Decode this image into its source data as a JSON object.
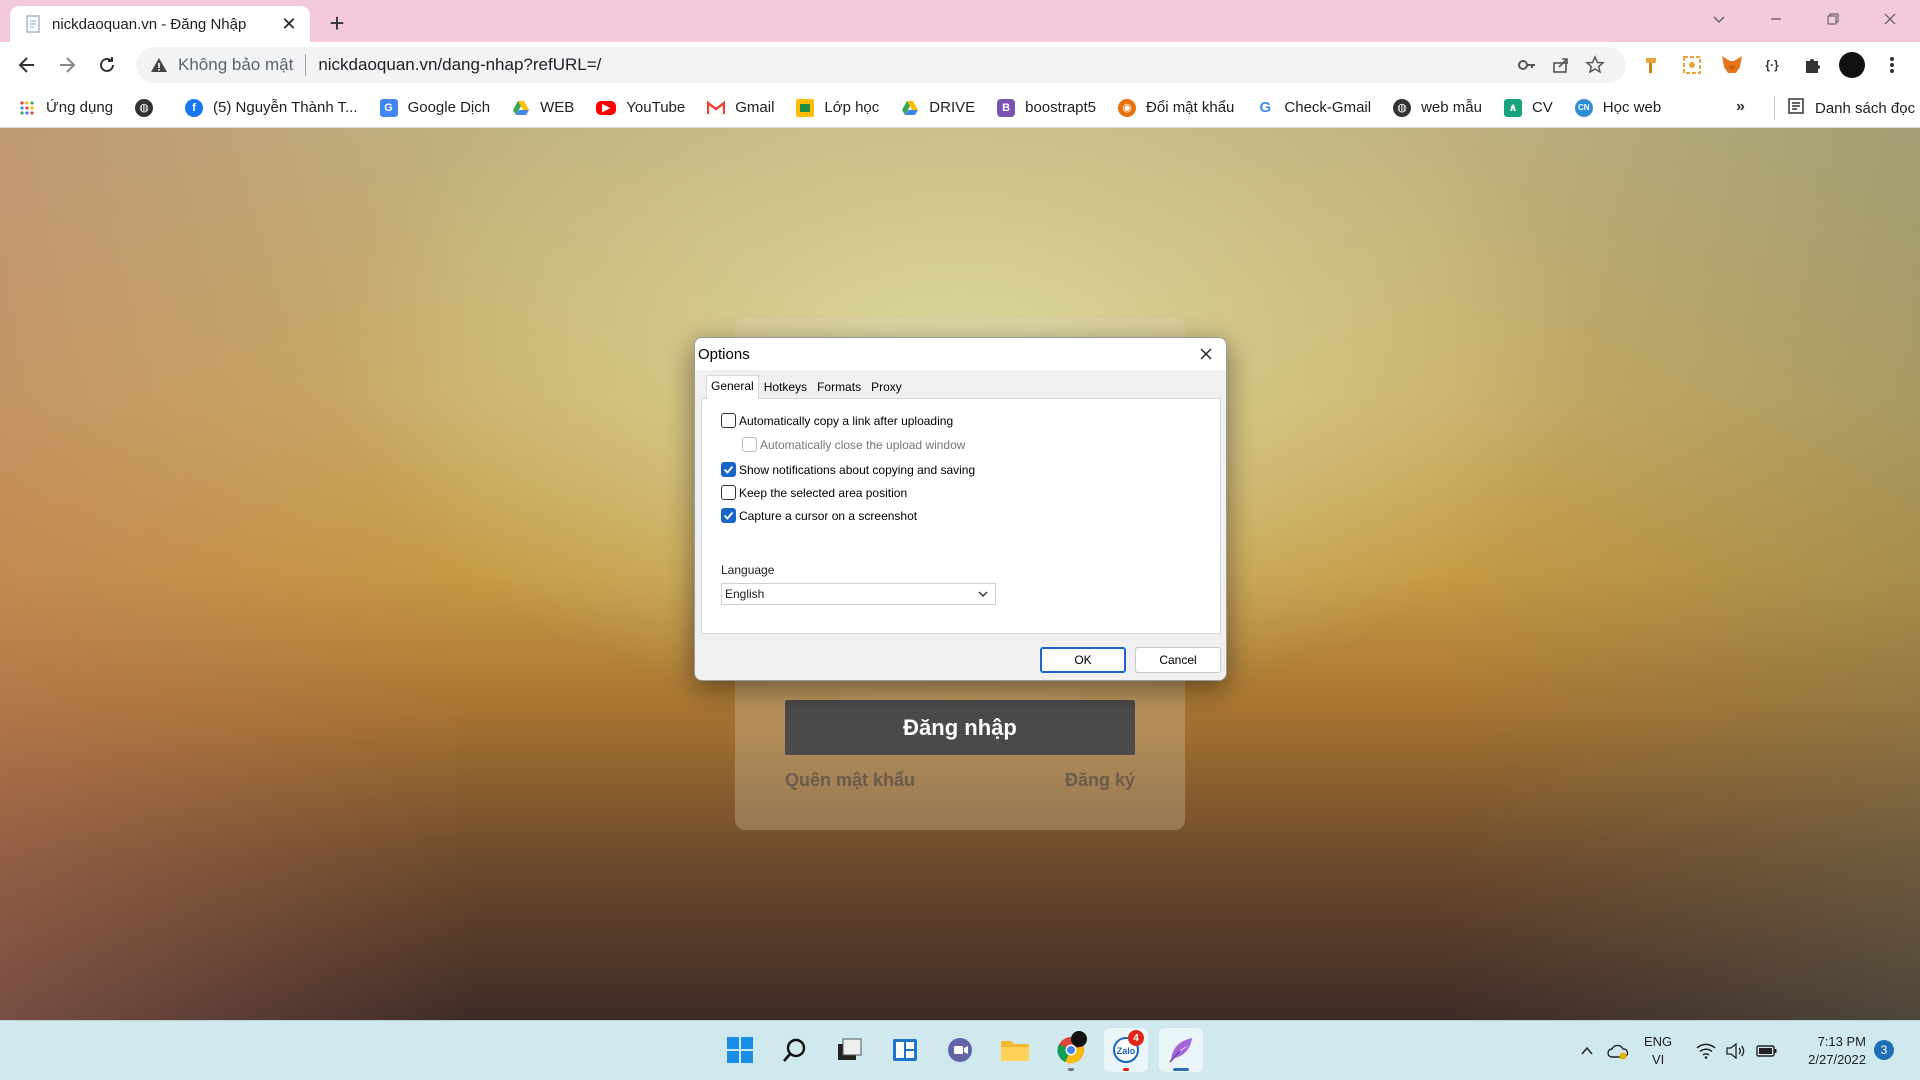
{
  "browser": {
    "tab_title": "nickdaoquan.vn - Đăng Nhập",
    "new_tab_icon": "plus-icon",
    "omnibox": {
      "security_label": "Không bảo mật",
      "url": "nickdaoquan.vn/dang-nhap?refURL=/"
    },
    "bookmarks": [
      {
        "label": "Ứng dụng",
        "icon": "apps-grid-icon",
        "color": "#ea4335"
      },
      {
        "label": "",
        "icon": "globe-icon",
        "color": "#333333"
      },
      {
        "label": "(5) Nguyễn Thành T...",
        "icon": "facebook-icon",
        "color": "#1877f2"
      },
      {
        "label": "Google Dịch",
        "icon": "google-translate-icon",
        "color": "#4285f4"
      },
      {
        "label": "WEB",
        "icon": "google-drive-icon",
        "color": "#34a853"
      },
      {
        "label": "YouTube",
        "icon": "youtube-icon",
        "color": "#ff0000"
      },
      {
        "label": "Gmail",
        "icon": "gmail-icon",
        "color": "#ea4335"
      },
      {
        "label": "Lớp học",
        "icon": "classroom-icon",
        "color": "#fbbc04"
      },
      {
        "label": "DRIVE",
        "icon": "google-drive-icon",
        "color": "#34a853"
      },
      {
        "label": "boostrapt5",
        "icon": "bootstrap-icon",
        "color": "#7952b3"
      },
      {
        "label": "Đổi mật khẩu",
        "icon": "pumpkin-icon",
        "color": "#e8710a"
      },
      {
        "label": "Check-Gmail",
        "icon": "google-icon",
        "color": "#4285f4"
      },
      {
        "label": "web mẫu",
        "icon": "globe-icon",
        "color": "#333333"
      },
      {
        "label": "CV",
        "icon": "cv-icon",
        "color": "#1aa37a"
      },
      {
        "label": "Học web",
        "icon": "cn-icon",
        "color": "#2b8fd6"
      }
    ],
    "more_bookmarks": "»",
    "reading_list": "Danh sách đọc"
  },
  "page": {
    "login_button": "Đăng nhập",
    "forgot_password": "Quên mật khẩu",
    "register": "Đăng ký"
  },
  "dialog": {
    "title": "Options",
    "tabs": [
      "General",
      "Hotkeys",
      "Formats",
      "Proxy"
    ],
    "active_tab": "General",
    "options": [
      {
        "label": "Automatically copy a link after uploading",
        "checked": false,
        "disabled": false,
        "indent": false
      },
      {
        "label": "Automatically close the upload window",
        "checked": false,
        "disabled": true,
        "indent": true
      },
      {
        "label": "Show notifications about copying and saving",
        "checked": true,
        "disabled": false,
        "indent": false
      },
      {
        "label": "Keep the selected area position",
        "checked": false,
        "disabled": false,
        "indent": false
      },
      {
        "label": "Capture a cursor on a screenshot",
        "checked": true,
        "disabled": false,
        "indent": false
      }
    ],
    "language_label": "Language",
    "language_value": "English",
    "ok": "OK",
    "cancel": "Cancel"
  },
  "taskbar": {
    "zalo_badge": "4",
    "lang_top": "ENG",
    "lang_bottom": "VI",
    "time": "7:13 PM",
    "date": "2/27/2022",
    "notifications": "3"
  },
  "colors": {
    "accent": "#1a66c8",
    "tabstrip": "#f4c9dc",
    "taskbar": "#cfe9ef"
  }
}
